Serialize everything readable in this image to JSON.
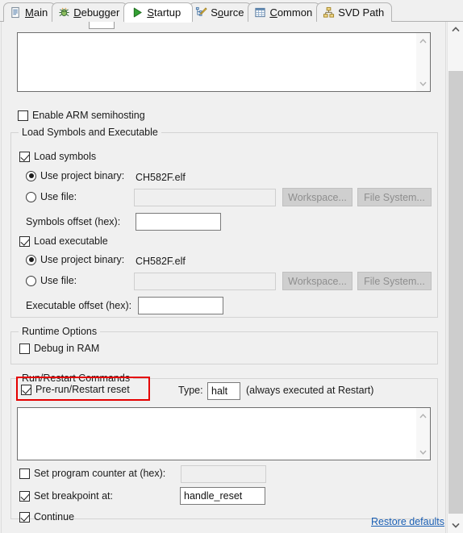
{
  "window": {
    "title": "Startup",
    "background": "#f0f0f0",
    "accent_link_color": "#1a5fb4",
    "highlight_color": "#e50000"
  },
  "tabs": [
    {
      "label": "Main",
      "icon": "document-icon",
      "mnemonic": "M",
      "active": false
    },
    {
      "label": "Debugger",
      "icon": "bug-icon",
      "mnemonic": "D",
      "active": false
    },
    {
      "label": "Startup",
      "icon": "play-icon",
      "mnemonic": "S",
      "active": true
    },
    {
      "label": "Source",
      "icon": "source-edit-icon",
      "mnemonic": "o",
      "active": false
    },
    {
      "label": "Common",
      "icon": "table-icon",
      "mnemonic": "C",
      "active": false
    },
    {
      "label": "SVD Path",
      "icon": "hierarchy-icon",
      "mnemonic": "",
      "active": false
    }
  ],
  "init_commands": {
    "textarea_value": "",
    "semihosting": {
      "label": "Enable ARM semihosting",
      "checked": false
    }
  },
  "load_group": {
    "title": "Load Symbols and Executable",
    "load_symbols": {
      "label": "Load symbols",
      "checked": true
    },
    "symbols_project_binary": {
      "label": "Use project binary:",
      "selected": true,
      "value": "CH582F.elf"
    },
    "symbols_use_file": {
      "label": "Use file:",
      "selected": false,
      "value": ""
    },
    "symbols_workspace_button": "Workspace...",
    "symbols_filesystem_button": "File System...",
    "symbols_offset": {
      "label": "Symbols offset (hex):",
      "value": ""
    },
    "load_executable": {
      "label": "Load executable",
      "checked": true
    },
    "exec_project_binary": {
      "label": "Use project binary:",
      "selected": true,
      "value": "CH582F.elf"
    },
    "exec_use_file": {
      "label": "Use file:",
      "selected": false,
      "value": ""
    },
    "exec_workspace_button": "Workspace...",
    "exec_filesystem_button": "File System...",
    "exec_offset": {
      "label": "Executable offset (hex):",
      "value": ""
    }
  },
  "runtime_group": {
    "title": "Runtime Options",
    "debug_in_ram": {
      "label": "Debug in RAM",
      "checked": false
    }
  },
  "run_restart_group": {
    "title": "Run/Restart Commands",
    "pre_run_reset": {
      "label": "Pre-run/Restart reset",
      "checked": true,
      "highlighted": true
    },
    "type_label": "Type:",
    "type_value": "halt",
    "type_note": "(always executed at Restart)",
    "commands_textarea_value": "",
    "set_pc": {
      "label": "Set program counter at (hex):",
      "checked": false,
      "value": "",
      "enabled": false
    },
    "set_breakpoint": {
      "label": "Set breakpoint at:",
      "checked": true,
      "value": "handle_reset",
      "enabled": true
    },
    "continue": {
      "label": "Continue",
      "checked": true
    }
  },
  "footer": {
    "restore_defaults": "Restore defaults"
  }
}
